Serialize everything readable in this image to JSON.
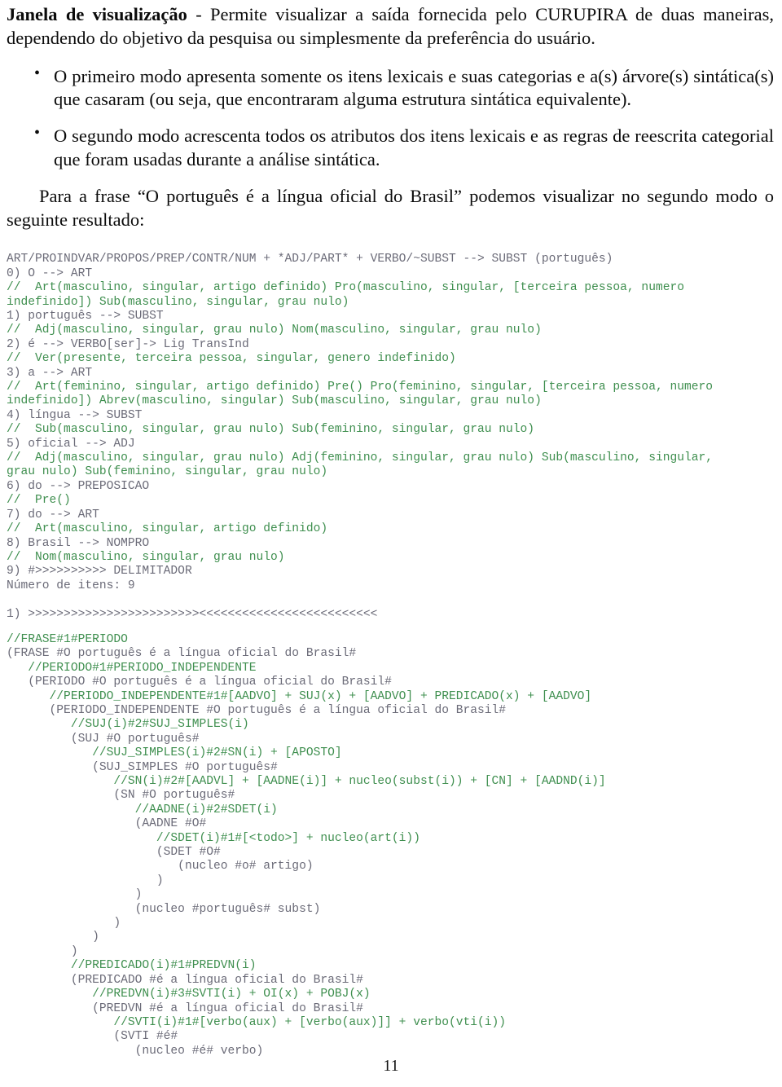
{
  "document": {
    "page_number": "11"
  },
  "intro": {
    "term": "Janela de visualização",
    "text": " - Permite visualizar a saída fornecida pelo CURUPIRA de duas maneiras, dependendo do objetivo da pesquisa ou simplesmente da preferência do usuário."
  },
  "bullets": [
    "O primeiro modo apresenta somente os itens lexicais e suas categorias e a(s) árvore(s) sintática(s) que casaram (ou seja, que encontraram alguma estrutura sintática equivalente).",
    "O segundo modo acrescenta todos os atributos dos itens lexicais e as regras de reescrita categorial que foram usadas durante a análise sintática."
  ],
  "paragraph_frase": "Para a frase “O português é a língua oficial do Brasil” podemos visualizar no segundo modo o seguinte resultado:",
  "code_output": {
    "lines": [
      {
        "color": "gray",
        "text": "ART/PROINDVAR/PROPOS/PREP/CONTR/NUM + *ADJ/PART* + VERBO/~SUBST --> SUBST (português)"
      },
      {
        "color": "gray",
        "text": "0) O --> ART"
      },
      {
        "color": "green",
        "text": "//  Art(masculino, singular, artigo definido) Pro(masculino, singular, [terceira pessoa, numero"
      },
      {
        "color": "green",
        "text": "indefinido]) Sub(masculino, singular, grau nulo)"
      },
      {
        "color": "gray",
        "text": "1) português --> SUBST"
      },
      {
        "color": "green",
        "text": "//  Adj(masculino, singular, grau nulo) Nom(masculino, singular, grau nulo)"
      },
      {
        "color": "gray",
        "text": "2) é --> VERBO[ser]-> Lig TransInd"
      },
      {
        "color": "green",
        "text": "//  Ver(presente, terceira pessoa, singular, genero indefinido)"
      },
      {
        "color": "gray",
        "text": "3) a --> ART"
      },
      {
        "color": "green",
        "text": "//  Art(feminino, singular, artigo definido) Pre() Pro(feminino, singular, [terceira pessoa, numero"
      },
      {
        "color": "green",
        "text": "indefinido]) Abrev(masculino, singular) Sub(masculino, singular, grau nulo)"
      },
      {
        "color": "gray",
        "text": "4) língua --> SUBST"
      },
      {
        "color": "green",
        "text": "//  Sub(masculino, singular, grau nulo) Sub(feminino, singular, grau nulo)"
      },
      {
        "color": "gray",
        "text": "5) oficial --> ADJ"
      },
      {
        "color": "green",
        "text": "//  Adj(masculino, singular, grau nulo) Adj(feminino, singular, grau nulo) Sub(masculino, singular,"
      },
      {
        "color": "green",
        "text": "grau nulo) Sub(feminino, singular, grau nulo)"
      },
      {
        "color": "gray",
        "text": "6) do --> PREPOSICAO"
      },
      {
        "color": "green",
        "text": "//  Pre()"
      },
      {
        "color": "gray",
        "text": "7) do --> ART"
      },
      {
        "color": "green",
        "text": "//  Art(masculino, singular, artigo definido)"
      },
      {
        "color": "gray",
        "text": "8) Brasil --> NOMPRO"
      },
      {
        "color": "green",
        "text": "//  Nom(masculino, singular, grau nulo)"
      },
      {
        "color": "gray",
        "text": "9) #>>>>>>>>>> DELIMITADOR"
      },
      {
        "color": "gray",
        "text": "Número de itens: 9"
      },
      {
        "color": "blank",
        "text": ""
      },
      {
        "color": "gray",
        "text": "1) >>>>>>>>>>>>>>>>>>>>>>>><<<<<<<<<<<<<<<<<<<<<<<<<"
      }
    ]
  },
  "code_tree": {
    "lines": [
      {
        "color": "green",
        "text": "//FRASE#1#PERIODO"
      },
      {
        "color": "gray",
        "text": "(FRASE #O português é a língua oficial do Brasil#"
      },
      {
        "color": "green",
        "text": "   //PERIODO#1#PERIODO_INDEPENDENTE"
      },
      {
        "color": "gray",
        "text": "   (PERIODO #O português é a língua oficial do Brasil#"
      },
      {
        "color": "green",
        "text": "      //PERIODO_INDEPENDENTE#1#[AADVO] + SUJ(x) + [AADVO] + PREDICADO(x) + [AADVO]"
      },
      {
        "color": "gray",
        "text": "      (PERIODO_INDEPENDENTE #O português é a língua oficial do Brasil#"
      },
      {
        "color": "green",
        "text": "         //SUJ(i)#2#SUJ_SIMPLES(i)"
      },
      {
        "color": "gray",
        "text": "         (SUJ #O português#"
      },
      {
        "color": "green",
        "text": "            //SUJ_SIMPLES(i)#2#SN(i) + [APOSTO]"
      },
      {
        "color": "gray",
        "text": "            (SUJ_SIMPLES #O português#"
      },
      {
        "color": "green",
        "text": "               //SN(i)#2#[AADVL] + [AADNE(i)] + nucleo(subst(i)) + [CN] + [AADND(i)]"
      },
      {
        "color": "gray",
        "text": "               (SN #O português#"
      },
      {
        "color": "green",
        "text": "                  //AADNE(i)#2#SDET(i)"
      },
      {
        "color": "gray",
        "text": "                  (AADNE #O#"
      },
      {
        "color": "green",
        "text": "                     //SDET(i)#1#[<todo>] + nucleo(art(i))"
      },
      {
        "color": "gray",
        "text": "                     (SDET #O#"
      },
      {
        "color": "gray",
        "text": "                        (nucleo #o# artigo)"
      },
      {
        "color": "gray",
        "text": "                     )"
      },
      {
        "color": "gray",
        "text": "                  )"
      },
      {
        "color": "gray",
        "text": "                  (nucleo #português# subst)"
      },
      {
        "color": "gray",
        "text": "               )"
      },
      {
        "color": "gray",
        "text": "            )"
      },
      {
        "color": "gray",
        "text": "         )"
      },
      {
        "color": "green",
        "text": "         //PREDICADO(i)#1#PREDVN(i)"
      },
      {
        "color": "gray",
        "text": "         (PREDICADO #é a língua oficial do Brasil#"
      },
      {
        "color": "green",
        "text": "            //PREDVN(i)#3#SVTI(i) + OI(x) + POBJ(x)"
      },
      {
        "color": "gray",
        "text": "            (PREDVN #é a língua oficial do Brasil#"
      },
      {
        "color": "green",
        "text": "               //SVTI(i)#1#[verbo(aux) + [verbo(aux)]] + verbo(vti(i))"
      },
      {
        "color": "gray",
        "text": "               (SVTI #é#"
      },
      {
        "color": "gray",
        "text": "                  (nucleo #é# verbo)"
      }
    ]
  },
  "colors": {
    "green": "#3f8f4f",
    "gray": "#6b6b78",
    "text": "#0b0b0b",
    "background": "#ffffff"
  }
}
